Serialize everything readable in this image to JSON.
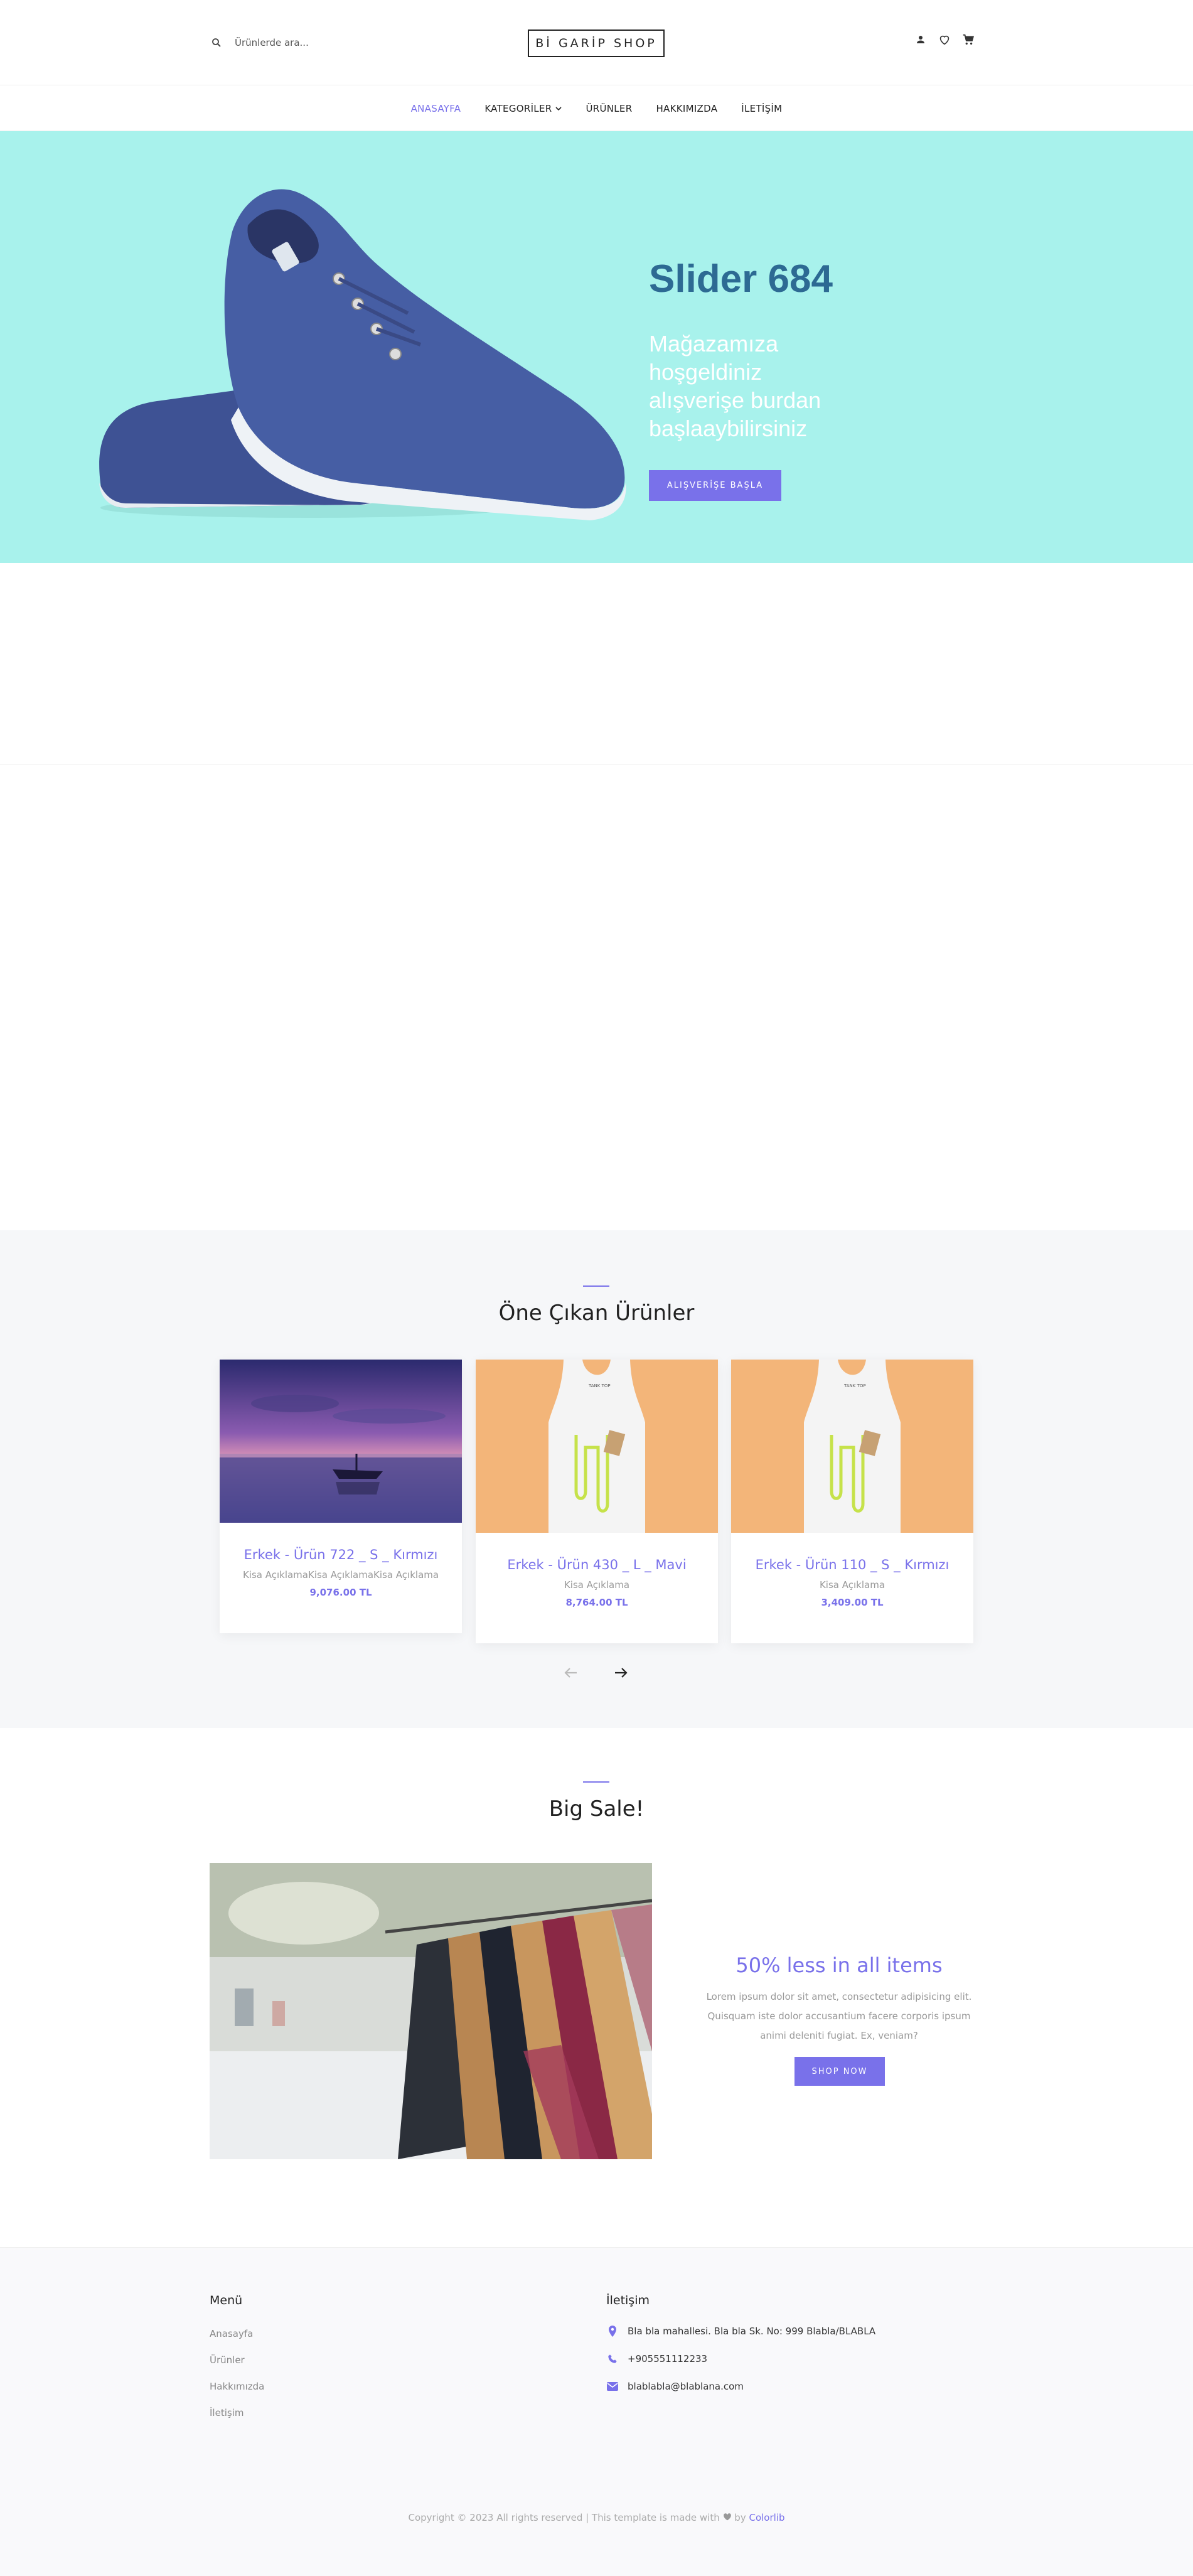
{
  "header": {
    "search_placeholder": "Ürünlerde ara...",
    "logo": "Bİ GARİP SHOP",
    "icons": [
      "person-icon",
      "heart-icon",
      "cart-icon"
    ]
  },
  "nav": {
    "items": [
      {
        "label": "ANASAYFA",
        "active": true
      },
      {
        "label": "KATEGORİLER",
        "dropdown": true
      },
      {
        "label": "ÜRÜNLER"
      },
      {
        "label": "HAKKIMIZDA"
      },
      {
        "label": "İLETİŞİM"
      }
    ]
  },
  "hero": {
    "title": "Slider 684",
    "subtitle": "Mağazamıza hoşgeldiniz alışverişe burdan başlaaybilirsiniz",
    "button": "ALIŞVERİŞE BAŞLA",
    "background": "#a8f2ec"
  },
  "featured": {
    "title": "Öne Çıkan Ürünler",
    "products": [
      {
        "name": "Erkek - Ürün 722 _ S _ Kırmızı",
        "description": "Kisa AçıklamaKisa AçıklamaKisa Açıklama",
        "price": "9,076.00 TL",
        "image": "sunset-boat-image"
      },
      {
        "name": "Erkek - Ürün 430 _ L _ Mavi",
        "description": "Kisa Açıklama",
        "price": "8,764.00 TL",
        "image": "tank-top-image"
      },
      {
        "name": "Erkek - Ürün 110 _ S _ Kırmızı",
        "description": "Kisa Açıklama",
        "price": "3,409.00 TL",
        "image": "tank-top-image"
      }
    ]
  },
  "sale": {
    "title": "Big Sale!",
    "heading": "50% less in all items",
    "text": "Lorem ipsum dolor sit amet, consectetur adipisicing elit. Quisquam iste dolor accusantium facere corporis ipsum animi deleniti fugiat. Ex, veniam?",
    "button": "SHOP NOW"
  },
  "footer": {
    "menu_title": "Menü",
    "menu": [
      "Anasayfa",
      "Ürünler",
      "Hakkımızda",
      "İletişim"
    ],
    "contact_title": "İletişim",
    "address": "Bla bla mahallesi. Bla bla Sk. No: 999 Blabla/BLABLA",
    "phone": "+905551112233",
    "email": "blablabla@blablana.com",
    "copyright_pre": "Copyright © 2023 All rights reserved | This template is made with",
    "copyright_by": "by",
    "copyright_brand": "Colorlib"
  },
  "colors": {
    "accent": "#7971ea",
    "hero_title": "#2d6a93"
  }
}
